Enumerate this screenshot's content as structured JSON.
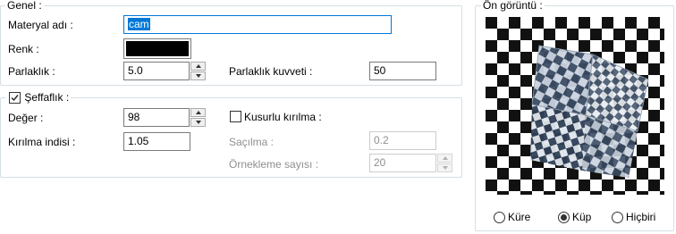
{
  "general": {
    "legend": "Genel :",
    "material_name_label": "Materyal adı :",
    "material_name_value": "cam",
    "color_label": "Renk :",
    "color_value": "#000000",
    "brightness_label": "Parlaklık :",
    "brightness_value": "5.0",
    "brightness_strength_label": "Parlaklık kuvveti :",
    "brightness_strength_value": "50"
  },
  "transparency": {
    "label": "Şeffaflık :",
    "checked": true,
    "value_label": "Değer :",
    "value": "98",
    "refraction_index_label": "Kırılma indisi :",
    "refraction_index_value": "1.05",
    "blurry_refraction_label": "Kusurlu kırılma :",
    "blurry_refraction_checked": false,
    "scatter_label": "Saçılma :",
    "scatter_value": "0.2",
    "sample_count_label": "Örnekleme sayısı :",
    "sample_count_value": "20"
  },
  "preview": {
    "legend": "Ön görüntü :",
    "shape_options": [
      "Küre",
      "Küp",
      "Hiçbiri"
    ],
    "selected_shape": "Küp"
  },
  "colors": {
    "accent": "#0078d7",
    "group_border": "#d5dfe5",
    "disabled_text": "#8f8f8f"
  }
}
